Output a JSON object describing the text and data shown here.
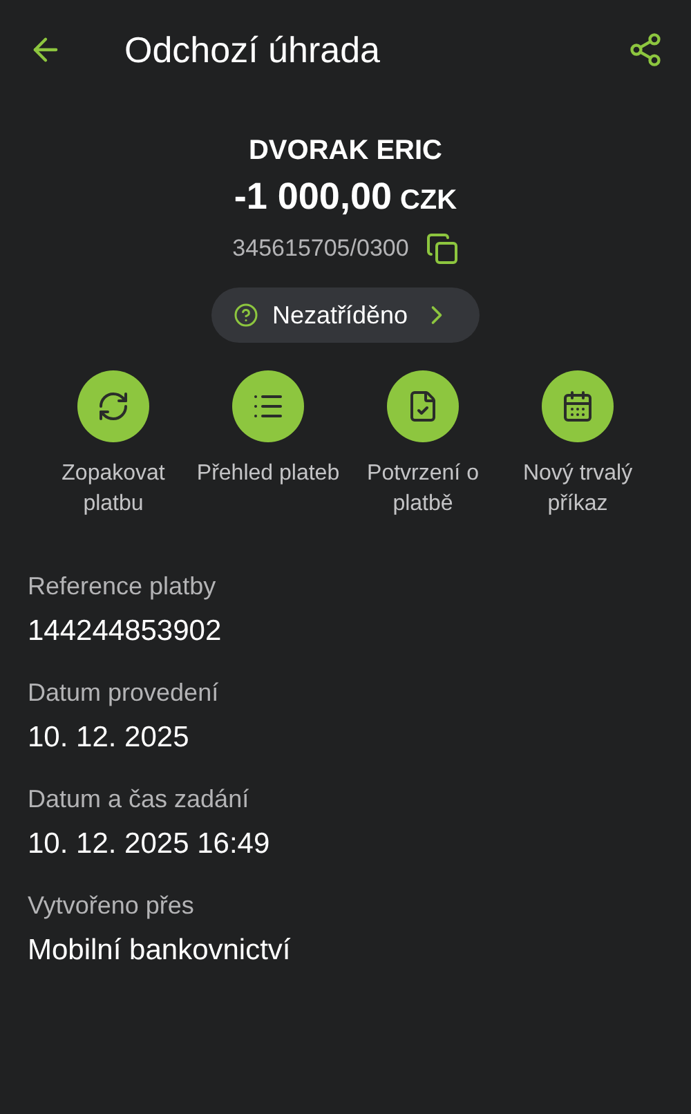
{
  "header": {
    "title": "Odchozí úhrada"
  },
  "payment": {
    "name": "DVORAK ERIC",
    "amount": "-1 000,00",
    "currency": "CZK",
    "account": "345615705/0300"
  },
  "category": {
    "label": "Nezatříděno"
  },
  "actions": [
    {
      "kind": "repeat",
      "label": "Zopakovat platbu"
    },
    {
      "kind": "list",
      "label": "Přehled plateb"
    },
    {
      "kind": "confirmation",
      "label": "Potvrzení o platbě"
    },
    {
      "kind": "calendar",
      "label": "Nový trvalý příkaz"
    }
  ],
  "details": [
    {
      "label": "Reference platby",
      "value": "144244853902"
    },
    {
      "label": "Datum provedení",
      "value": "10. 12. 2025"
    },
    {
      "label": "Datum a čas zadání",
      "value": "10. 12. 2025 16:49"
    },
    {
      "label": "Vytvořeno přes",
      "value": "Mobilní bankovnictví"
    }
  ]
}
